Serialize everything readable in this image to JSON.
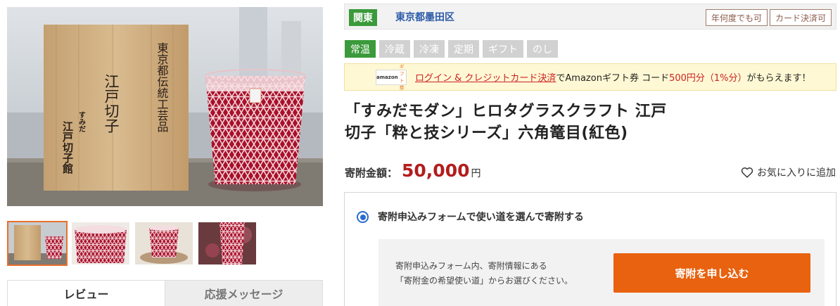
{
  "region": {
    "badge": "関東",
    "city": "東京都墨田区"
  },
  "payment_tags": [
    "年何度でも可",
    "カード決済可"
  ],
  "temperature_tags": [
    {
      "label": "常温",
      "active": true
    },
    {
      "label": "冷蔵",
      "active": false
    },
    {
      "label": "冷凍",
      "active": false
    },
    {
      "label": "定期",
      "active": false
    },
    {
      "label": "ギフト",
      "active": false
    },
    {
      "label": "のし",
      "active": false
    }
  ],
  "promo": {
    "card_logo": "amazon",
    "card_gift": "ギフト券",
    "link_text": "ログイン & クレジットカード決済",
    "text1": "でAmazonギフト券 コード",
    "highlight": "500円分（1%分）",
    "text2": "がもらえます！"
  },
  "product": {
    "title_line1": "「すみだモダン」ヒロタグラスクラフト 江戸",
    "title_line2": "切子「粋と技シリーズ」六角篭目(紅色)"
  },
  "price": {
    "label": "寄附金額：",
    "value": "50,000",
    "unit": "円"
  },
  "favorite": {
    "label": "お気に入りに追加"
  },
  "option": {
    "label": "寄附申込みフォームで使い道を選んで寄附する",
    "desc_line1": "寄附申込みフォーム内、寄附情報にある",
    "desc_line2": "「寄附金の希望使い道」からお選びください。",
    "button": "寄附を申し込む"
  },
  "tabs": {
    "review": "レビュー",
    "support": "応援メッセージ"
  },
  "image_text": {
    "box_label": "東京都伝統工芸品",
    "box_title": "江戸切子",
    "brand_small": "すみだ",
    "brand_main": "江戸切子館"
  },
  "colors": {
    "accent_orange": "#e8620f",
    "green": "#3b9a3b",
    "price_red": "#b21d1d",
    "link_blue": "#2c5ba8",
    "glass_red": "#b3102a"
  }
}
